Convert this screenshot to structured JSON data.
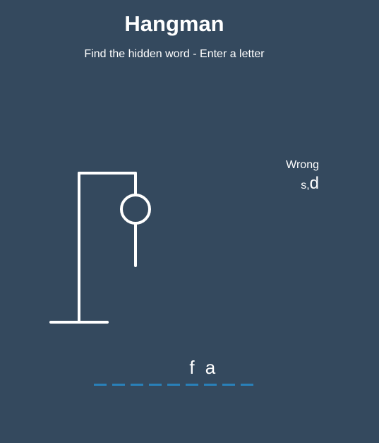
{
  "header": {
    "title": "Hangman",
    "subtitle": "Find the hidden word - Enter a letter"
  },
  "wrong": {
    "label": "Wrong",
    "letters": [
      "s",
      "d"
    ]
  },
  "word": {
    "slots": [
      "",
      "",
      "",
      "",
      "",
      "f",
      "a",
      "",
      ""
    ]
  },
  "colors": {
    "background": "#34495e",
    "text": "#ffffff",
    "slot_underline": "#2980b9"
  },
  "hangman": {
    "parts_shown": [
      "head",
      "body"
    ]
  }
}
